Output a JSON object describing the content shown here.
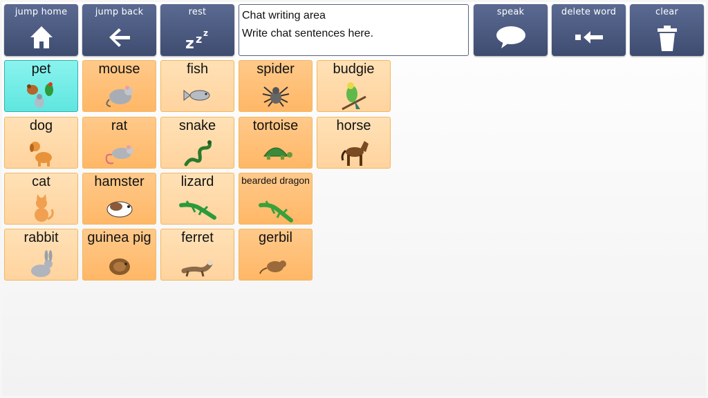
{
  "toolbar": {
    "jump_home": "jump home",
    "jump_back": "jump back",
    "rest": "rest",
    "speak": "speak",
    "delete_word": "delete word",
    "clear": "clear"
  },
  "chat": {
    "title": "Chat writing area",
    "hint": "Write chat sentences here."
  },
  "grid": {
    "cells": [
      {
        "label": "pet",
        "icon": "pets-icon"
      },
      {
        "label": "mouse",
        "icon": "mouse-icon"
      },
      {
        "label": "fish",
        "icon": "fish-icon"
      },
      {
        "label": "spider",
        "icon": "spider-icon"
      },
      {
        "label": "budgie",
        "icon": "budgie-icon"
      },
      {
        "label": "dog",
        "icon": "dog-icon"
      },
      {
        "label": "rat",
        "icon": "rat-icon"
      },
      {
        "label": "snake",
        "icon": "snake-icon"
      },
      {
        "label": "tortoise",
        "icon": "tortoise-icon"
      },
      {
        "label": "horse",
        "icon": "horse-icon"
      },
      {
        "label": "cat",
        "icon": "cat-icon"
      },
      {
        "label": "hamster",
        "icon": "hamster-icon"
      },
      {
        "label": "lizard",
        "icon": "lizard-icon"
      },
      {
        "label": "bearded dragon",
        "icon": "bearded-dragon-icon"
      },
      {
        "label": "rabbit",
        "icon": "rabbit-icon"
      },
      {
        "label": "guinea pig",
        "icon": "guinea-pig-icon"
      },
      {
        "label": "ferret",
        "icon": "ferret-icon"
      },
      {
        "label": "gerbil",
        "icon": "gerbil-icon"
      }
    ]
  },
  "colors": {
    "toolbar_bg": "#4a587c",
    "cell_light": "#ffd9aa",
    "cell_dark": "#ffc07a",
    "cell_selected": "#6cebe4"
  }
}
